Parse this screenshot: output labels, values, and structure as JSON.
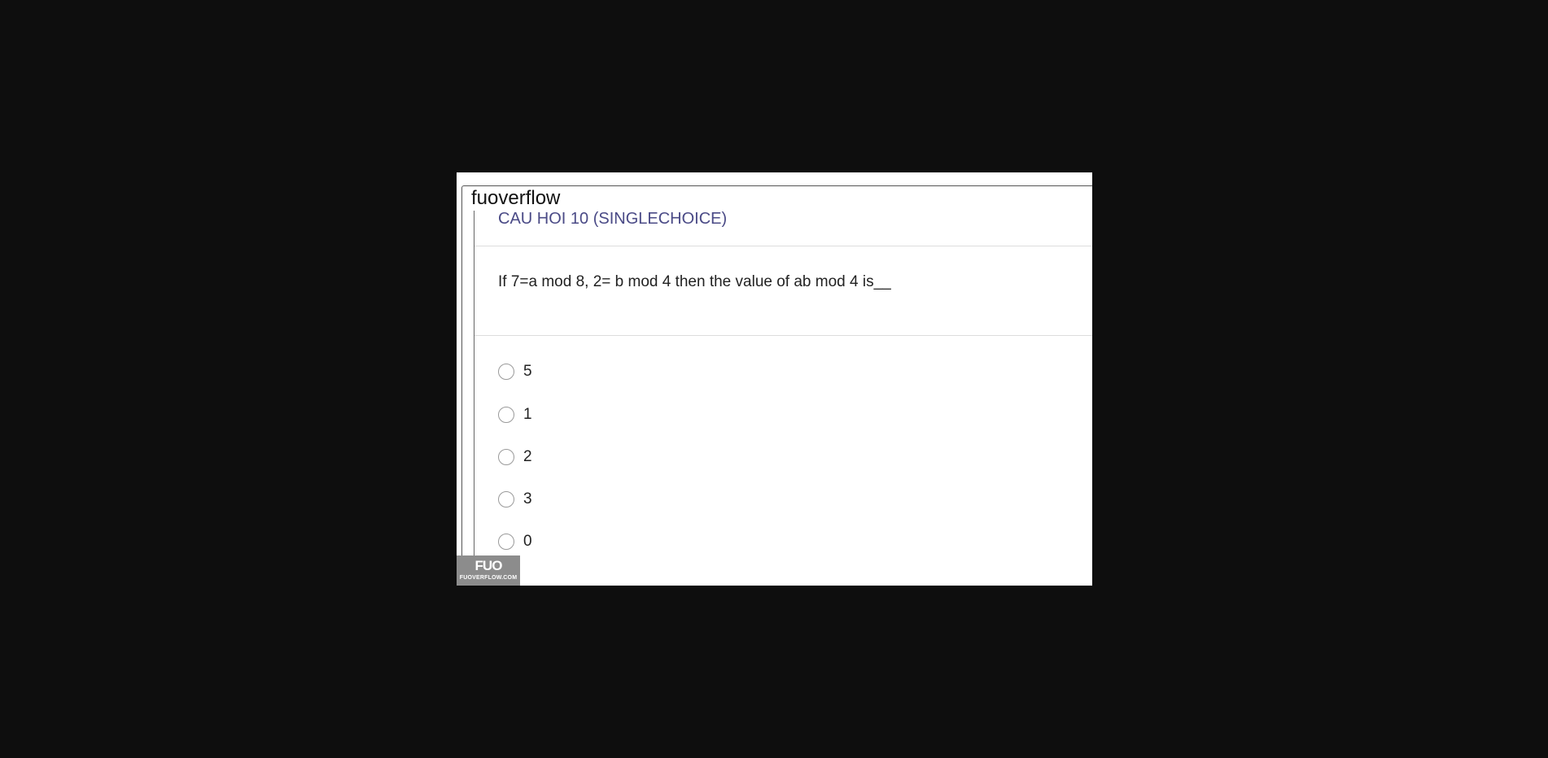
{
  "card": {
    "site_name": "fuoverflow",
    "question_title": "CAU HOI 10 (SINGLECHOICE)",
    "question_text": "If 7=a mod 8, 2= b mod 4 then the value of ab mod 4 is__",
    "options": [
      {
        "label": "5",
        "selected": false
      },
      {
        "label": "1",
        "selected": false
      },
      {
        "label": "2",
        "selected": false
      },
      {
        "label": "3",
        "selected": false
      },
      {
        "label": "0",
        "selected": false
      }
    ]
  },
  "watermark": {
    "logo_text": "FUO",
    "site_text": "FUOVERFLOW.COM"
  },
  "colors": {
    "page_background": "#0e0e0e",
    "card_background": "#ffffff",
    "title_color": "#4a4a86",
    "watermark_background": "#8c8c8c"
  }
}
